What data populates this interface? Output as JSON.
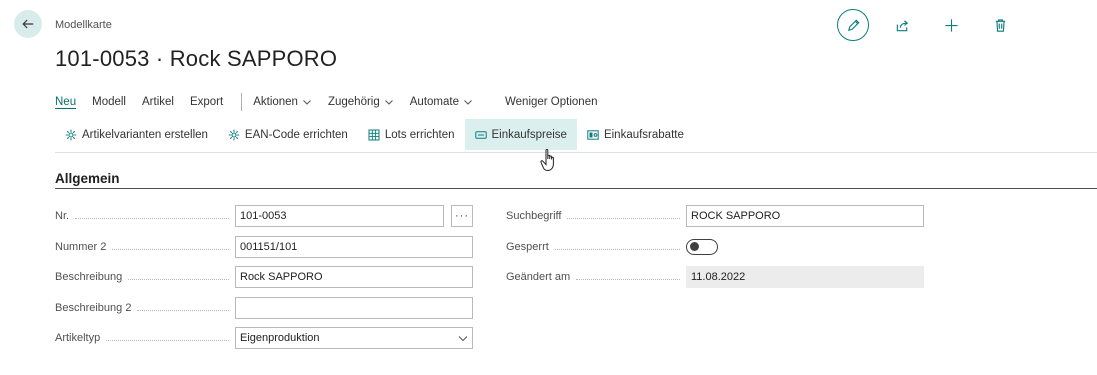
{
  "breadcrumb": "Modellkarte",
  "title": "101-0053 · Rock SAPPORO",
  "menu": {
    "items": [
      "Neu",
      "Modell",
      "Artikel",
      "Export"
    ],
    "dropdowns": [
      "Aktionen",
      "Zugehörig",
      "Automate"
    ],
    "less_options": "Weniger Optionen"
  },
  "actions": [
    {
      "label": "Artikelvarianten erstellen",
      "icon": "gear-icon"
    },
    {
      "label": "EAN-Code errichten",
      "icon": "gear-icon"
    },
    {
      "label": "Lots errichten",
      "icon": "grid-icon"
    },
    {
      "label": "Einkaufspreise",
      "icon": "price-tag-icon"
    },
    {
      "label": "Einkaufsrabatte",
      "icon": "discount-icon"
    }
  ],
  "section": {
    "title": "Allgemein"
  },
  "fields_left": [
    {
      "label": "Nr.",
      "value": "101-0053"
    },
    {
      "label": "Nummer 2",
      "value": "001151/101"
    },
    {
      "label": "Beschreibung",
      "value": "Rock SAPPORO"
    },
    {
      "label": "Beschreibung 2",
      "value": ""
    },
    {
      "label": "Artikeltyp",
      "value": "Eigenproduktion"
    }
  ],
  "fields_right": [
    {
      "label": "Suchbegriff",
      "value": "ROCK SAPPORO"
    },
    {
      "label": "Gesperrt",
      "value": false
    },
    {
      "label": "Geändert am",
      "value": "11.08.2022"
    }
  ],
  "colors": {
    "accent": "#0b7d7d",
    "hover": "#dcefef",
    "back_button_bg": "#d8ecec"
  }
}
